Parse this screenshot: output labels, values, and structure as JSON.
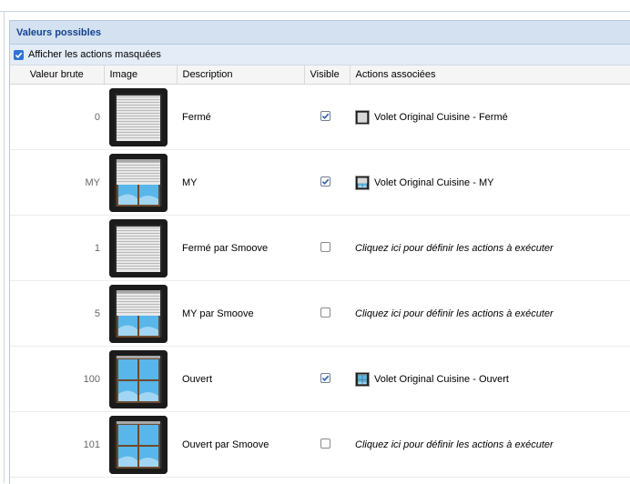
{
  "panel": {
    "title": "Valeurs possibles",
    "show_hidden_label": "Afficher les actions masquées",
    "show_hidden_checked": true
  },
  "columns": {
    "raw": "Valeur brute",
    "image": "Image",
    "description": "Description",
    "visible": "Visible",
    "actions": "Actions associées"
  },
  "rows": [
    {
      "raw": "0",
      "image": "shutter-closed",
      "description": "Fermé",
      "visible": true,
      "action": "Volet Original Cuisine - Fermé",
      "action_icon": "shutter-closed"
    },
    {
      "raw": "MY",
      "image": "shutter-my",
      "description": "MY",
      "visible": true,
      "action": "Volet Original Cuisine - MY",
      "action_icon": "shutter-my"
    },
    {
      "raw": "1",
      "image": "shutter-closed",
      "description": "Fermé par Smoove",
      "visible": false,
      "action": "Cliquez ici pour définir les actions à exécuter",
      "action_icon": ""
    },
    {
      "raw": "5",
      "image": "shutter-my",
      "description": "MY par Smoove",
      "visible": false,
      "action": "Cliquez ici pour définir les actions à exécuter",
      "action_icon": ""
    },
    {
      "raw": "100",
      "image": "shutter-open",
      "description": "Ouvert",
      "visible": true,
      "action": "Volet Original Cuisine - Ouvert",
      "action_icon": "shutter-open"
    },
    {
      "raw": "101",
      "image": "shutter-open",
      "description": "Ouvert par Smoove",
      "visible": false,
      "action": "Cliquez ici pour définir les actions à exécuter",
      "action_icon": ""
    }
  ],
  "colors": {
    "header_bg": "#d3e1f1",
    "header_text": "#15428b",
    "option_bg": "#e4ecf7"
  }
}
